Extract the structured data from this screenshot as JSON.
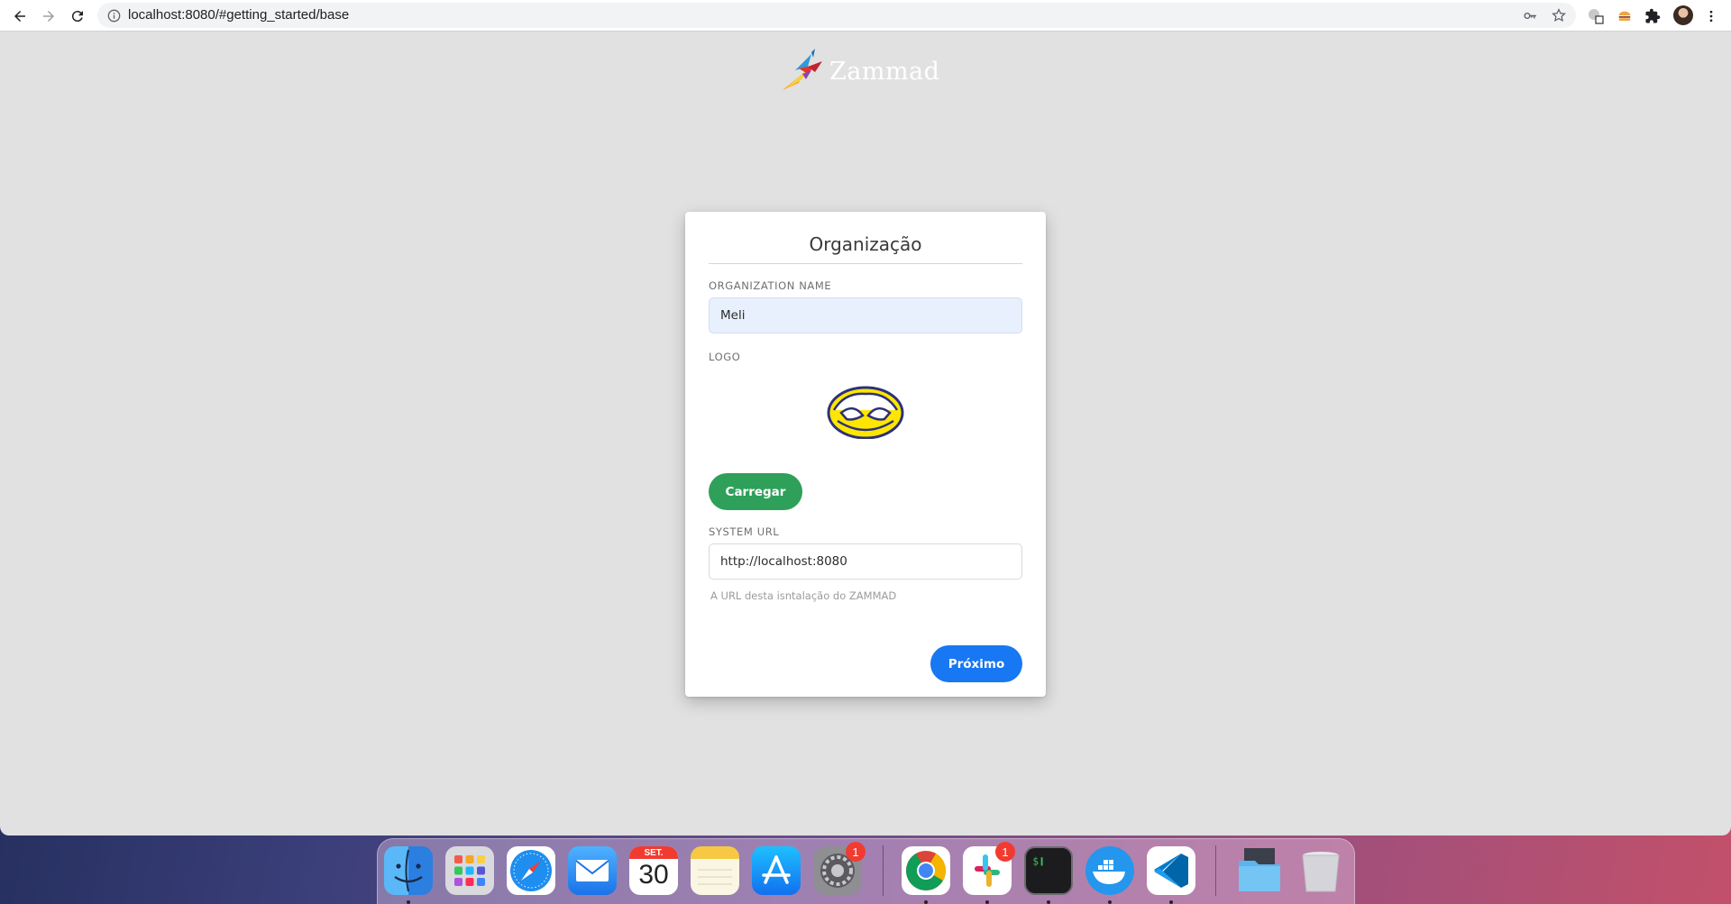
{
  "browser": {
    "url": "localhost:8080/#getting_started/base",
    "icons": [
      "back-arrow-icon",
      "forward-arrow-icon",
      "reload-icon",
      "site-info-icon",
      "key-icon",
      "bookmark-star-icon",
      "translate-extension-icon",
      "burger-extension-icon",
      "puzzle-extensions-icon",
      "profile-avatar",
      "kebab-menu-icon"
    ]
  },
  "brand": {
    "name": "Zammad"
  },
  "setup": {
    "title": "Organização",
    "org_label": "ORGANIZATION NAME",
    "org_value": "Meli",
    "logo_label": "LOGO",
    "upload_label": "Carregar",
    "url_label": "SYSTEM URL",
    "url_value": "http://localhost:8080",
    "url_help": "A URL desta isntalação do ZAMMAD",
    "next_label": "Próximo"
  },
  "dock": {
    "calendar_month": "SET.",
    "calendar_day": "30",
    "system_prefs_badge": "1",
    "slack_badge": "1",
    "apps": [
      "Finder",
      "Launchpad",
      "Safari",
      "Mail",
      "Calendar",
      "Notes",
      "App Store",
      "System Preferences",
      "Chrome",
      "Slack",
      "Terminal",
      "Docker",
      "Visual Studio Code",
      "Downloads",
      "Trash"
    ]
  },
  "colors": {
    "page_bg": "#e1e1e1",
    "upload_button": "#2ea05a",
    "next_button": "#1877f2",
    "autofill_bg": "#e8f0fe"
  }
}
